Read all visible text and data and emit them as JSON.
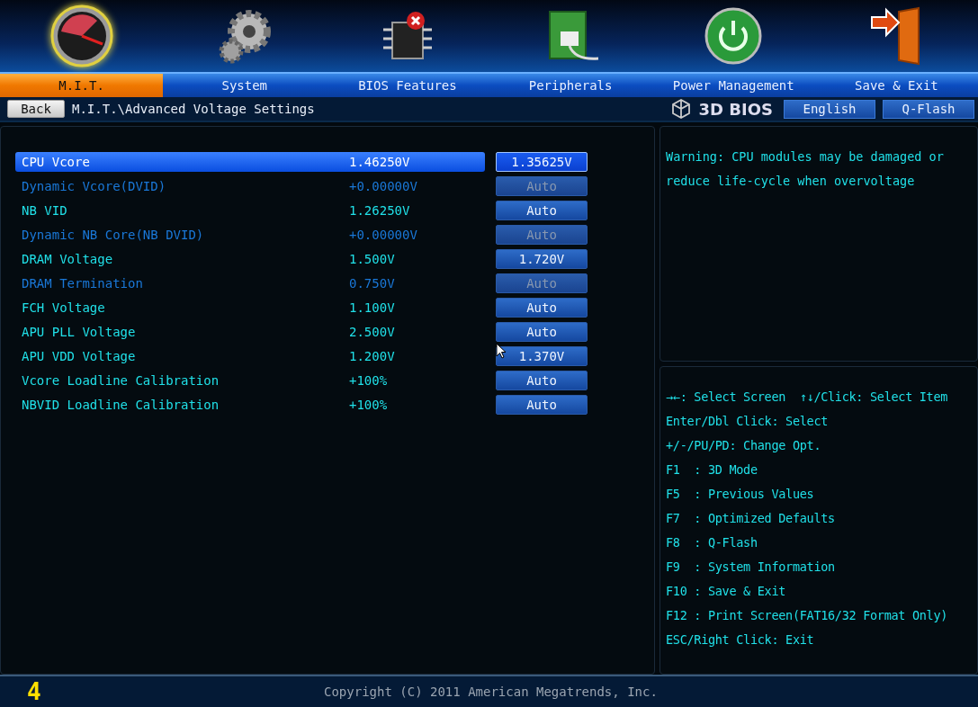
{
  "tabs": [
    {
      "label": "M.I.T.",
      "kind": "gauge",
      "selected": true
    },
    {
      "label": "System",
      "kind": "gear",
      "selected": false
    },
    {
      "label": "BIOS Features",
      "kind": "chip",
      "selected": false
    },
    {
      "label": "Peripherals",
      "kind": "card",
      "selected": false
    },
    {
      "label": "Power Management",
      "kind": "power",
      "selected": false
    },
    {
      "label": "Save & Exit",
      "kind": "door",
      "selected": false
    }
  ],
  "nav": {
    "back": "Back",
    "breadcrumb": "M.I.T.\\Advanced Voltage Settings",
    "logo": "3D BIOS",
    "buttons": [
      "English",
      "Q-Flash"
    ]
  },
  "settings": [
    {
      "label": "CPU Vcore",
      "value": "1.46250V",
      "setting": "1.35625V",
      "selected": true,
      "disabled": false
    },
    {
      "label": "Dynamic Vcore(DVID)",
      "value": "+0.00000V",
      "setting": "Auto",
      "selected": false,
      "disabled": true
    },
    {
      "label": "NB VID",
      "value": "1.26250V",
      "setting": "Auto",
      "selected": false,
      "disabled": false
    },
    {
      "label": "Dynamic NB Core(NB DVID)",
      "value": "+0.00000V",
      "setting": "Auto",
      "selected": false,
      "disabled": true
    },
    {
      "label": "DRAM Voltage",
      "value": "1.500V",
      "setting": "1.720V",
      "selected": false,
      "disabled": false
    },
    {
      "label": "DRAM Termination",
      "value": "0.750V",
      "setting": "Auto",
      "selected": false,
      "disabled": true
    },
    {
      "label": "FCH Voltage",
      "value": "1.100V",
      "setting": "Auto",
      "selected": false,
      "disabled": false
    },
    {
      "label": "APU PLL Voltage",
      "value": "2.500V",
      "setting": "Auto",
      "selected": false,
      "disabled": false
    },
    {
      "label": "APU VDD Voltage",
      "value": "1.200V",
      "setting": "1.370V",
      "selected": false,
      "disabled": false
    },
    {
      "label": "Vcore Loadline Calibration",
      "value": "+100%",
      "setting": "Auto",
      "selected": false,
      "disabled": false
    },
    {
      "label": "NBVID Loadline Calibration",
      "value": "+100%",
      "setting": "Auto",
      "selected": false,
      "disabled": false
    }
  ],
  "help_text": "Warning: CPU modules may be damaged or reduce life-cycle when overvoltage",
  "key_help": [
    "→←: Select Screen  ↑↓/Click: Select Item",
    "Enter/Dbl Click: Select",
    "+/-/PU/PD: Change Opt.",
    "F1  : 3D Mode",
    "F5  : Previous Values",
    "F7  : Optimized Defaults",
    "F8  : Q-Flash",
    "F9  : System Information",
    "F10 : Save & Exit",
    "F12 : Print Screen(FAT16/32 Format Only)",
    "ESC/Right Click: Exit"
  ],
  "footer": {
    "post_code": "4",
    "copyright": "Copyright (C) 2011 American Megatrends, Inc."
  }
}
